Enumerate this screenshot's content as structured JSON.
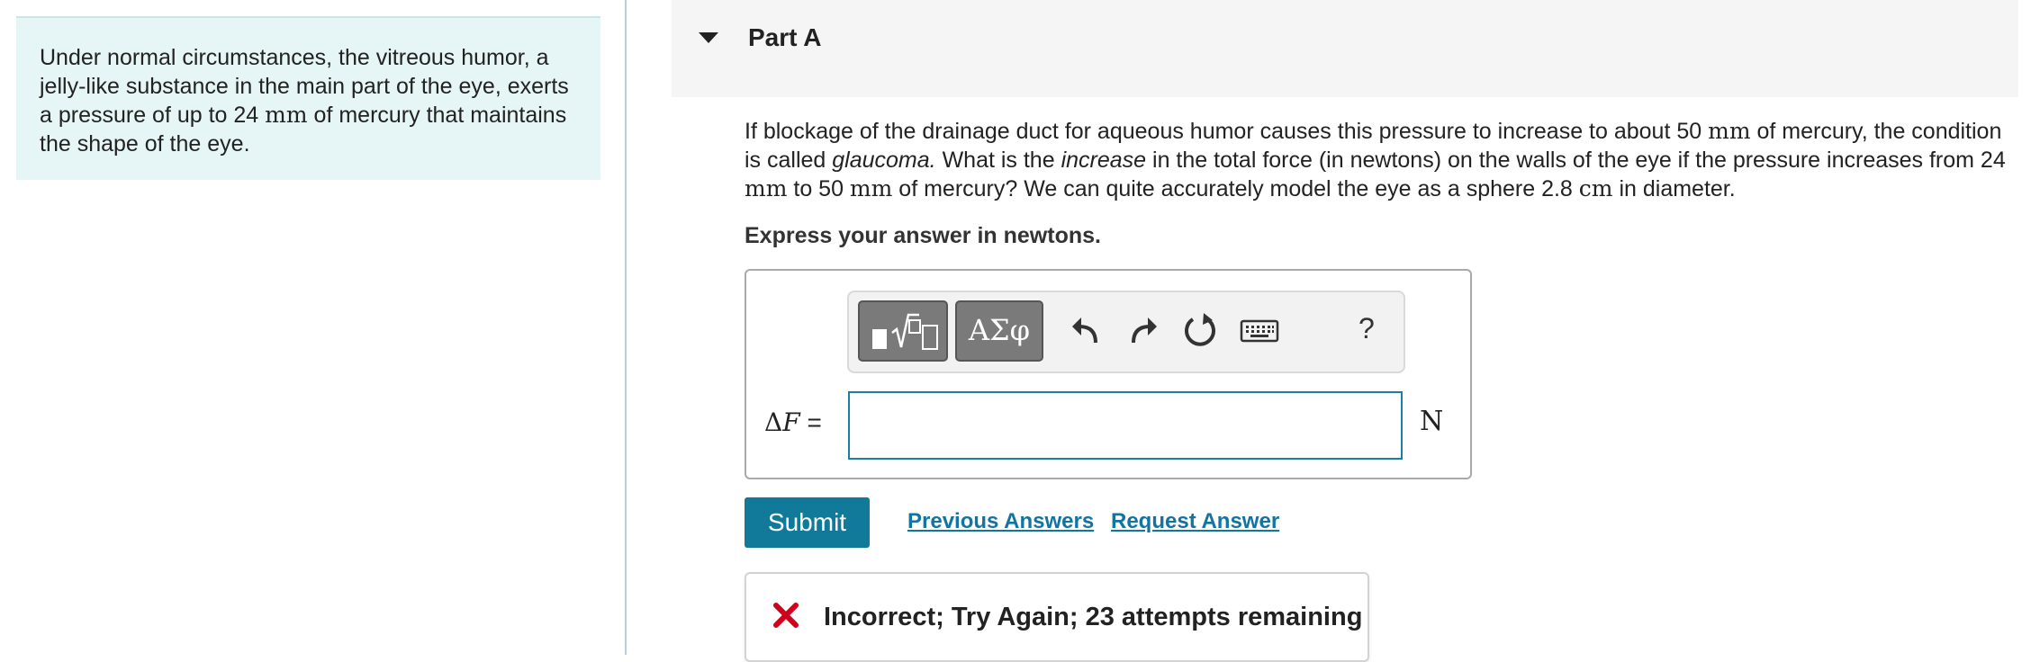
{
  "intro": {
    "text_before": "Under normal circumstances, the vitreous humor, a jelly-like substance in the main part of the eye, exerts a pressure of up to 24 ",
    "unit": "mm",
    "text_after": " of mercury that maintains the shape of the eye."
  },
  "part": {
    "title": "Part A"
  },
  "question": {
    "s1": "If blockage of the drainage duct for aqueous humor causes this pressure to increase to about 50 ",
    "u1": "mm",
    "s2": " of mercury, the condition is called ",
    "em1": "glaucoma.",
    "s3": " What is the ",
    "em2": "increase",
    "s4": " in the total force (in newtons) on the walls of the eye if the pressure increases from 24 ",
    "u2": "mm",
    "s5": " to 50 ",
    "u3": "mm",
    "s6": " of mercury? We can quite accurately model the eye as a sphere 2.8 ",
    "u4": "cm",
    "s7": " in diameter."
  },
  "instruction": "Express your answer in newtons.",
  "toolbar": {
    "templates_icon": "templates-icon",
    "symbols_label": "ΑΣφ",
    "undo_icon": "undo-icon",
    "redo_icon": "redo-icon",
    "reset_icon": "reset-icon",
    "keyboard_icon": "keyboard-icon",
    "help_label": "?"
  },
  "answer": {
    "label_delta": "Δ",
    "label_var": "F",
    "label_eq": " =",
    "value": "",
    "unit": "N"
  },
  "actions": {
    "submit": "Submit",
    "previous_answers": "Previous Answers",
    "request_answer": "Request Answer"
  },
  "feedback": {
    "icon": "x-icon",
    "text": "Incorrect; Try Again; 23 attempts remaining"
  },
  "colors": {
    "intro_bg": "#e6f5f5",
    "accent": "#117a9b",
    "link": "#1373a1",
    "error": "#d0021b"
  }
}
